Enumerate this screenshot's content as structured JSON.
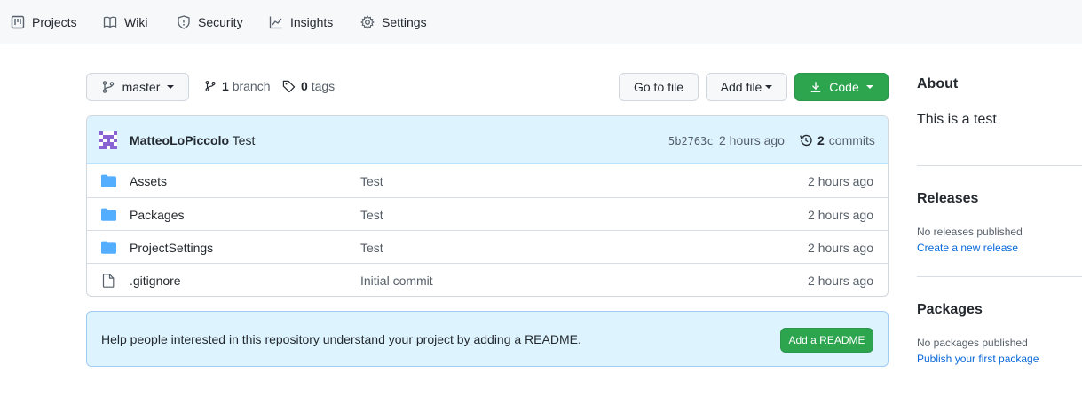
{
  "nav": {
    "items": [
      {
        "label": "Projects",
        "icon": "project-icon"
      },
      {
        "label": "Wiki",
        "icon": "book-icon"
      },
      {
        "label": "Security",
        "icon": "shield-icon"
      },
      {
        "label": "Insights",
        "icon": "graph-icon"
      },
      {
        "label": "Settings",
        "icon": "gear-icon"
      }
    ]
  },
  "toolbar": {
    "branch_selector": "master",
    "branch_count": "1",
    "branch_label": "branch",
    "tag_count": "0",
    "tag_label": "tags",
    "go_to_file": "Go to file",
    "add_file": "Add file",
    "code": "Code"
  },
  "commit": {
    "author": "MatteoLoPiccolo",
    "message": "Test",
    "sha": "5b2763c",
    "time": "2 hours ago",
    "commit_count": "2",
    "commit_label": "commits"
  },
  "files": [
    {
      "name": "Assets",
      "type": "folder",
      "message": "Test",
      "time": "2 hours ago"
    },
    {
      "name": "Packages",
      "type": "folder",
      "message": "Test",
      "time": "2 hours ago"
    },
    {
      "name": "ProjectSettings",
      "type": "folder",
      "message": "Test",
      "time": "2 hours ago"
    },
    {
      "name": ".gitignore",
      "type": "file",
      "message": "Initial commit",
      "time": "2 hours ago"
    }
  ],
  "readme": {
    "text": "Help people interested in this repository understand your project by adding a README.",
    "button": "Add a README"
  },
  "sidebar": {
    "about_title": "About",
    "about_text": "This is a test",
    "releases_title": "Releases",
    "releases_empty": "No releases published",
    "releases_link": "Create a new release",
    "packages_title": "Packages",
    "packages_empty": "No packages published",
    "packages_link": "Publish your first package"
  },
  "colors": {
    "accent_green": "#2da44e",
    "link_blue": "#0969da",
    "folder_blue": "#54aeff",
    "header_bg": "#ddf4ff"
  }
}
